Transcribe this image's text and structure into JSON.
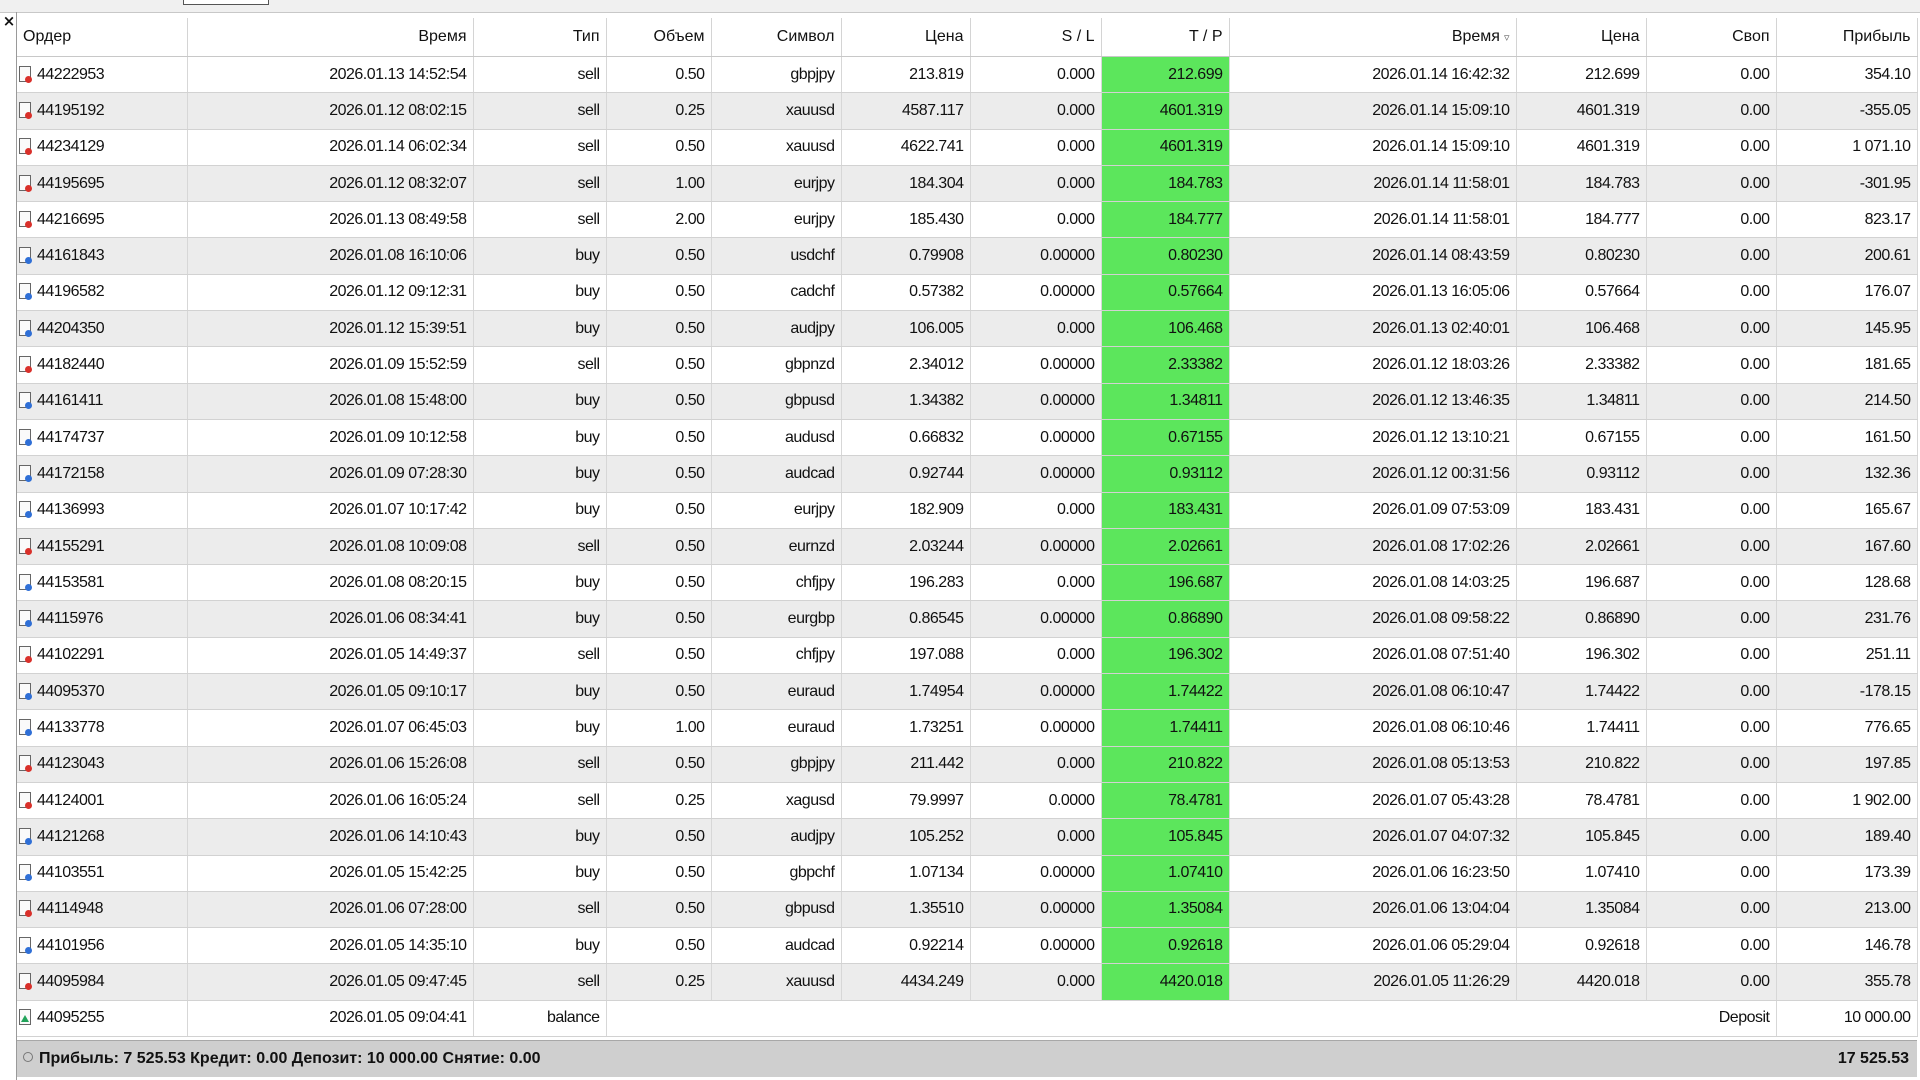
{
  "window": {
    "close_glyph": "×"
  },
  "columns": [
    "Ордер",
    "Время",
    "Тип",
    "Объем",
    "Символ",
    "Цена",
    "S / L",
    "T / P",
    "Время",
    "Цена",
    "Своп",
    "Прибыль"
  ],
  "sort_icon": "sort-desc-icon",
  "colors": {
    "tp_highlight": "#5ce65c",
    "sell_icon": "#d9302a",
    "buy_icon": "#2f6fd6",
    "balance_icon": "#21a35a"
  },
  "rows": [
    [
      "44222953",
      "2026.01.13 14:52:54",
      "sell",
      "0.50",
      "gbpjpy",
      "213.819",
      "0.000",
      "212.699",
      "2026.01.14 16:42:32",
      "212.699",
      "0.00",
      "354.10"
    ],
    [
      "44195192",
      "2026.01.12 08:02:15",
      "sell",
      "0.25",
      "xauusd",
      "4587.117",
      "0.000",
      "4601.319",
      "2026.01.14 15:09:10",
      "4601.319",
      "0.00",
      "-355.05"
    ],
    [
      "44234129",
      "2026.01.14 06:02:34",
      "sell",
      "0.50",
      "xauusd",
      "4622.741",
      "0.000",
      "4601.319",
      "2026.01.14 15:09:10",
      "4601.319",
      "0.00",
      "1 071.10"
    ],
    [
      "44195695",
      "2026.01.12 08:32:07",
      "sell",
      "1.00",
      "eurjpy",
      "184.304",
      "0.000",
      "184.783",
      "2026.01.14 11:58:01",
      "184.783",
      "0.00",
      "-301.95"
    ],
    [
      "44216695",
      "2026.01.13 08:49:58",
      "sell",
      "2.00",
      "eurjpy",
      "185.430",
      "0.000",
      "184.777",
      "2026.01.14 11:58:01",
      "184.777",
      "0.00",
      "823.17"
    ],
    [
      "44161843",
      "2026.01.08 16:10:06",
      "buy",
      "0.50",
      "usdchf",
      "0.79908",
      "0.00000",
      "0.80230",
      "2026.01.14 08:43:59",
      "0.80230",
      "0.00",
      "200.61"
    ],
    [
      "44196582",
      "2026.01.12 09:12:31",
      "buy",
      "0.50",
      "cadchf",
      "0.57382",
      "0.00000",
      "0.57664",
      "2026.01.13 16:05:06",
      "0.57664",
      "0.00",
      "176.07"
    ],
    [
      "44204350",
      "2026.01.12 15:39:51",
      "buy",
      "0.50",
      "audjpy",
      "106.005",
      "0.000",
      "106.468",
      "2026.01.13 02:40:01",
      "106.468",
      "0.00",
      "145.95"
    ],
    [
      "44182440",
      "2026.01.09 15:52:59",
      "sell",
      "0.50",
      "gbpnzd",
      "2.34012",
      "0.00000",
      "2.33382",
      "2026.01.12 18:03:26",
      "2.33382",
      "0.00",
      "181.65"
    ],
    [
      "44161411",
      "2026.01.08 15:48:00",
      "buy",
      "0.50",
      "gbpusd",
      "1.34382",
      "0.00000",
      "1.34811",
      "2026.01.12 13:46:35",
      "1.34811",
      "0.00",
      "214.50"
    ],
    [
      "44174737",
      "2026.01.09 10:12:58",
      "buy",
      "0.50",
      "audusd",
      "0.66832",
      "0.00000",
      "0.67155",
      "2026.01.12 13:10:21",
      "0.67155",
      "0.00",
      "161.50"
    ],
    [
      "44172158",
      "2026.01.09 07:28:30",
      "buy",
      "0.50",
      "audcad",
      "0.92744",
      "0.00000",
      "0.93112",
      "2026.01.12 00:31:56",
      "0.93112",
      "0.00",
      "132.36"
    ],
    [
      "44136993",
      "2026.01.07 10:17:42",
      "buy",
      "0.50",
      "eurjpy",
      "182.909",
      "0.000",
      "183.431",
      "2026.01.09 07:53:09",
      "183.431",
      "0.00",
      "165.67"
    ],
    [
      "44155291",
      "2026.01.08 10:09:08",
      "sell",
      "0.50",
      "eurnzd",
      "2.03244",
      "0.00000",
      "2.02661",
      "2026.01.08 17:02:26",
      "2.02661",
      "0.00",
      "167.60"
    ],
    [
      "44153581",
      "2026.01.08 08:20:15",
      "buy",
      "0.50",
      "chfjpy",
      "196.283",
      "0.000",
      "196.687",
      "2026.01.08 14:03:25",
      "196.687",
      "0.00",
      "128.68"
    ],
    [
      "44115976",
      "2026.01.06 08:34:41",
      "buy",
      "0.50",
      "eurgbp",
      "0.86545",
      "0.00000",
      "0.86890",
      "2026.01.08 09:58:22",
      "0.86890",
      "0.00",
      "231.76"
    ],
    [
      "44102291",
      "2026.01.05 14:49:37",
      "sell",
      "0.50",
      "chfjpy",
      "197.088",
      "0.000",
      "196.302",
      "2026.01.08 07:51:40",
      "196.302",
      "0.00",
      "251.11"
    ],
    [
      "44095370",
      "2026.01.05 09:10:17",
      "buy",
      "0.50",
      "euraud",
      "1.74954",
      "0.00000",
      "1.74422",
      "2026.01.08 06:10:47",
      "1.74422",
      "0.00",
      "-178.15"
    ],
    [
      "44133778",
      "2026.01.07 06:45:03",
      "buy",
      "1.00",
      "euraud",
      "1.73251",
      "0.00000",
      "1.74411",
      "2026.01.08 06:10:46",
      "1.74411",
      "0.00",
      "776.65"
    ],
    [
      "44123043",
      "2026.01.06 15:26:08",
      "sell",
      "0.50",
      "gbpjpy",
      "211.442",
      "0.000",
      "210.822",
      "2026.01.08 05:13:53",
      "210.822",
      "0.00",
      "197.85"
    ],
    [
      "44124001",
      "2026.01.06 16:05:24",
      "sell",
      "0.25",
      "xagusd",
      "79.9997",
      "0.0000",
      "78.4781",
      "2026.01.07 05:43:28",
      "78.4781",
      "0.00",
      "1 902.00"
    ],
    [
      "44121268",
      "2026.01.06 14:10:43",
      "buy",
      "0.50",
      "audjpy",
      "105.252",
      "0.000",
      "105.845",
      "2026.01.07 04:07:32",
      "105.845",
      "0.00",
      "189.40"
    ],
    [
      "44103551",
      "2026.01.05 15:42:25",
      "buy",
      "0.50",
      "gbpchf",
      "1.07134",
      "0.00000",
      "1.07410",
      "2026.01.06 16:23:50",
      "1.07410",
      "0.00",
      "173.39"
    ],
    [
      "44114948",
      "2026.01.06 07:28:00",
      "sell",
      "0.50",
      "gbpusd",
      "1.35510",
      "0.00000",
      "1.35084",
      "2026.01.06 13:04:04",
      "1.35084",
      "0.00",
      "213.00"
    ],
    [
      "44101956",
      "2026.01.05 14:35:10",
      "buy",
      "0.50",
      "audcad",
      "0.92214",
      "0.00000",
      "0.92618",
      "2026.01.06 05:29:04",
      "0.92618",
      "0.00",
      "146.78"
    ],
    [
      "44095984",
      "2026.01.05 09:47:45",
      "sell",
      "0.25",
      "xauusd",
      "4434.249",
      "0.000",
      "4420.018",
      "2026.01.05 11:26:29",
      "4420.018",
      "0.00",
      "355.78"
    ]
  ],
  "balance_row": {
    "order": "44095255",
    "time": "2026.01.05 09:04:41",
    "type": "balance",
    "comment": "Deposit",
    "amount": "10 000.00"
  },
  "status": {
    "summary": "Прибыль: 7 525.53  Кредит: 0.00  Депозит: 10 000.00  Снятие: 0.00",
    "total": "17 525.53"
  }
}
